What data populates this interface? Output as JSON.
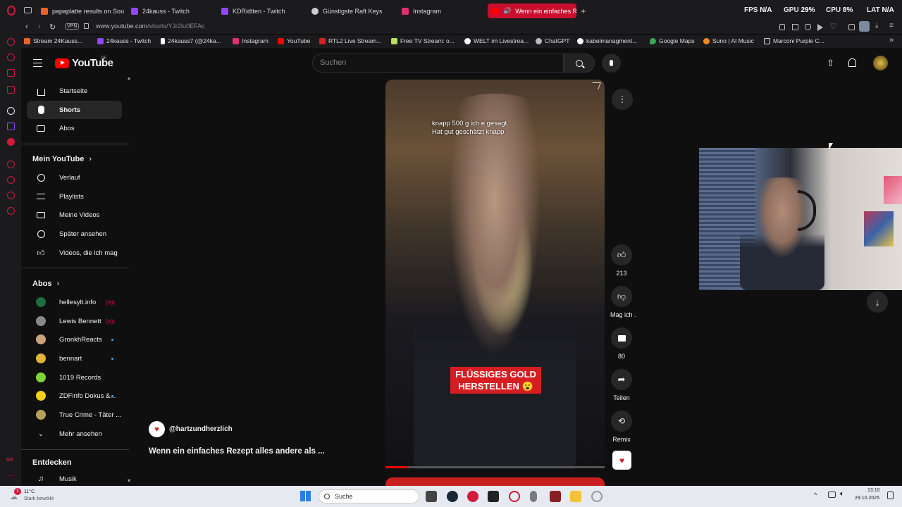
{
  "browser": {
    "tabs": [
      {
        "label": "papaplatte results on Sou",
        "color": "#e8632b"
      },
      {
        "label": "24kauss - Twitch",
        "color": "#9146ff"
      },
      {
        "label": "KDRidtten - Twitch",
        "color": "#9146ff"
      },
      {
        "label": "Günstigste Raft Keys",
        "color": "#cccccc"
      },
      {
        "label": "Instagram",
        "color": "#e1306c"
      },
      {
        "label": "Wenn ein einfaches R",
        "color": "#ff0000"
      }
    ],
    "new_tab": "+",
    "stats": {
      "fps_label": "FPS",
      "fps_value": "N/A",
      "gpu_label": "GPU",
      "gpu_value": "29%",
      "cpu_label": "CPU",
      "cpu_value": "8%",
      "lat_label": "LAT",
      "lat_value": "N/A"
    },
    "vpn_label": "VPN",
    "url_host": "www.youtube.com",
    "url_path": "/shorts/YJr2lu0EFAc",
    "bookmarks": [
      {
        "label": "Stream 24Kauss...",
        "color": "#e8632b"
      },
      {
        "label": "24kauss - Twitch",
        "color": "#9146ff"
      },
      {
        "label": "24kauss7 (@24ka...",
        "color": "#ffffff"
      },
      {
        "label": "Instagram",
        "color": "#e1306c"
      },
      {
        "label": "YouTube",
        "color": "#ff0000"
      },
      {
        "label": "RTL2 Live Stream...",
        "color": "#d51f26"
      },
      {
        "label": "Free TV Stream: o...",
        "color": "#b6e35a"
      },
      {
        "label": "WELT im Livestrea...",
        "color": "#ffffff"
      },
      {
        "label": "ChatGPT",
        "color": "#bbbbbb"
      },
      {
        "label": "kabelmanagment...",
        "color": "#ffffff"
      },
      {
        "label": "Google Maps",
        "color": "#34a853"
      },
      {
        "label": "Suno | AI Music",
        "color": "#f08a24"
      },
      {
        "label": "Marconi Purple C...",
        "color": "#dddddd"
      }
    ]
  },
  "youtube": {
    "logo_text": "YouTube",
    "country": "DE",
    "search_placeholder": "Suchen",
    "nav": [
      {
        "label": "Startseite",
        "icon": "home-icon"
      },
      {
        "label": "Shorts",
        "icon": "shorts-icon"
      },
      {
        "label": "Abos",
        "icon": "subscriptions-icon"
      }
    ],
    "you_title": "Mein YouTube",
    "you_items": [
      {
        "label": "Verlauf",
        "icon": "history-icon"
      },
      {
        "label": "Playlists",
        "icon": "playlists-icon"
      },
      {
        "label": "Meine Videos",
        "icon": "your-videos-icon"
      },
      {
        "label": "Später ansehen",
        "icon": "watch-later-icon"
      },
      {
        "label": "Videos, die ich mag",
        "icon": "liked-videos-icon"
      }
    ],
    "subs_title": "Abos",
    "subscriptions": [
      {
        "label": "hellesylt.info",
        "color": "#1e6e3c",
        "live": true
      },
      {
        "label": "Lewis Bennett",
        "color": "#888888",
        "live": true
      },
      {
        "label": "GronkhReacts",
        "color": "#c9a47a",
        "live": false
      },
      {
        "label": "bennart",
        "color": "#e0b43a",
        "live": false
      },
      {
        "label": "1019 Records",
        "color": "#7fd43a",
        "live": false
      },
      {
        "label": "ZDFinfo Dokus &...",
        "color": "#f4d120",
        "live": false
      },
      {
        "label": "True Crime - Täter ...",
        "color": "#b7a15a",
        "live": false
      }
    ],
    "show_more": "Mehr ansehen",
    "explore_title": "Entdecken",
    "explore_items": [
      {
        "label": "Musik",
        "icon": "music-icon"
      }
    ],
    "short": {
      "caption_line1": "knapp 500 g ich e gesagt.",
      "caption_line2": "Hat gut geschätzt knapp",
      "overlay_line1": "FLÜSSIGES GOLD",
      "overlay_line2": "HERSTELLEN 😮",
      "channel": "@hartzundherzlich",
      "title": "Wenn ein einfaches Rezept alles andere als ...",
      "progress": 0.1
    },
    "actions": {
      "likes": "213",
      "dislike_label": "Mag ich .",
      "comments": "80",
      "share_label": "Teilen",
      "remix_label": "Remix"
    }
  },
  "taskbar": {
    "weather_temp": "11°C",
    "weather_desc": "Stark bewölkt",
    "search_placeholder": "Suche",
    "time": "13:10",
    "date": "29.10.2025"
  }
}
